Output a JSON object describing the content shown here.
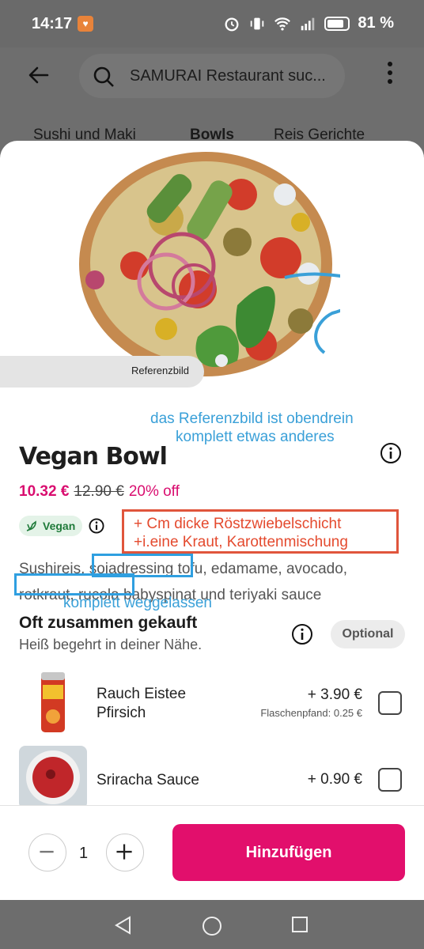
{
  "status": {
    "time": "14:17",
    "battery": "81 %"
  },
  "appbar": {
    "search_text": "SAMURAI Restaurant suc..."
  },
  "categories": [
    "Sushi und Maki",
    "Bowls",
    "Reis Gerichte"
  ],
  "product": {
    "ref_label": "Referenzbild",
    "title": "Vegan Bowl",
    "price_now": "10.32 €",
    "price_old": "12.90 €",
    "discount": "20% off",
    "badge": "Vegan",
    "desc_line1_a": "Sushireis, ",
    "desc_line1_b": "sojadressing",
    "desc_line1_c": " tofu, edamame, avocado,",
    "desc_line2_a": "rotkraut, rucola",
    "desc_line2_b": " babyspinat und teriyaki sauce"
  },
  "annotations": {
    "ref_note_1": "das Referenzbild ist obendrein",
    "ref_note_2": "komplett etwas anderes",
    "red_line1": "+ Cm dicke Röstzwiebelschicht",
    "red_line2": "+i.eine Kraut, Karottenmischung",
    "omitted": "komplett weggelassen"
  },
  "often": {
    "title": "Oft zusammen gekauft",
    "subtitle": "Heiß begehrt in deiner Nähe.",
    "optional": "Optional",
    "items": [
      {
        "name_1": "Rauch Eistee",
        "name_2": "Pfirsich",
        "price": "+ 3.90 €",
        "deposit": "Flaschenpfand: 0.25 €"
      },
      {
        "name_1": "Sriracha Sauce",
        "price": "+ 0.90 €"
      }
    ]
  },
  "footer": {
    "quantity": "1",
    "add_label": "Hinzufügen"
  },
  "colors": {
    "accent": "#e20f6c",
    "annot_blue": "#3aa0d8",
    "annot_red": "#e0553c"
  }
}
